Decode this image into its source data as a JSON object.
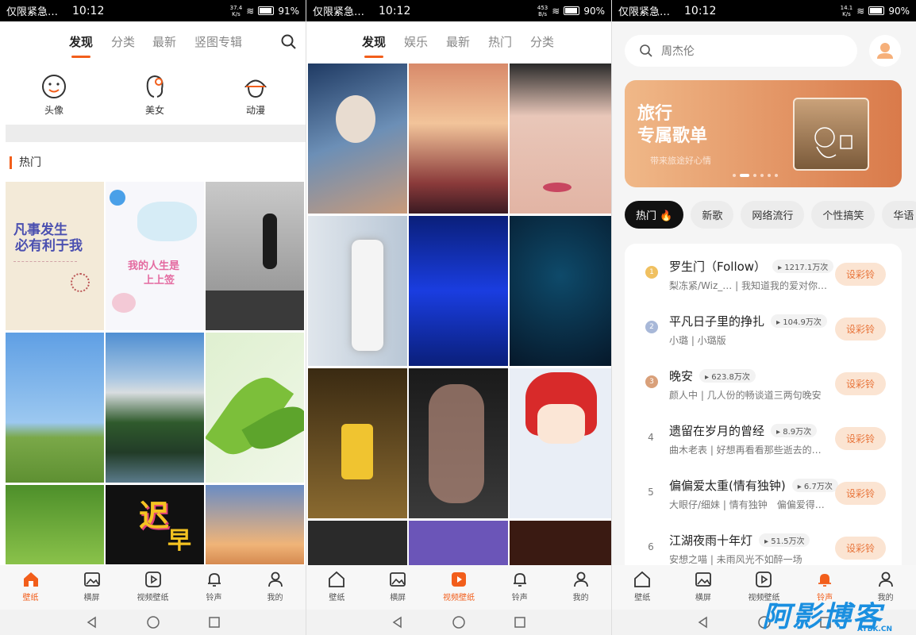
{
  "status": {
    "p1": {
      "carrier": "仅限紧急…",
      "time": "10:12",
      "speed_top": "37.4",
      "speed_unit": "K/s",
      "battery": "91%"
    },
    "p2": {
      "carrier": "仅限紧急…",
      "time": "10:12",
      "speed_top": "453",
      "speed_unit": "B/s",
      "battery": "90%"
    },
    "p3": {
      "carrier": "仅限紧急…",
      "time": "10:12",
      "speed_top": "14.1",
      "speed_unit": "K/s",
      "battery": "90%"
    }
  },
  "p1": {
    "tabs": [
      "发现",
      "分类",
      "最新",
      "竖图专辑"
    ],
    "categories": [
      {
        "label": "头像",
        "icon": "smile-face-icon"
      },
      {
        "label": "美女",
        "icon": "girl-face-icon"
      },
      {
        "label": "动漫",
        "icon": "anime-face-icon"
      }
    ],
    "hot_title": "热门",
    "tile_text": {
      "a": "凡事发生",
      "b": "必有利于我",
      "c": "我的人生是",
      "d": "上上签",
      "e": "迟",
      "f": "早"
    }
  },
  "p2": {
    "tabs": [
      "发现",
      "娱乐",
      "最新",
      "热门",
      "分类"
    ]
  },
  "p3": {
    "search_placeholder": "周杰伦",
    "banner": {
      "title1": "旅行",
      "title2": "专属歌单",
      "subtitle": "带来旅途好心情"
    },
    "chips": [
      "热门 🔥",
      "新歌",
      "网络流行",
      "个性搞笑",
      "华语"
    ],
    "songs": [
      {
        "rank": "1",
        "title": "罗生门（Follow）",
        "plays": "▸ 1217.1万次",
        "sub": "梨冻紧/Wiz_… | 我知道我的爱对你…",
        "btn": "设彩铃"
      },
      {
        "rank": "2",
        "title": "平凡日子里的挣扎",
        "plays": "▸ 104.9万次",
        "sub": "小璐 | 小璐版",
        "btn": "设彩铃"
      },
      {
        "rank": "3",
        "title": "晚安",
        "plays": "▸ 623.8万次",
        "sub": "颜人中 | 几人份的畅谈道三两句晚安",
        "btn": "设彩铃"
      },
      {
        "rank": "4",
        "title": "遗留在岁月的曾经",
        "plays": "▸ 8.9万次",
        "sub": "曲木老表 | 好想再看看那些逝去的…",
        "btn": "设彩铃"
      },
      {
        "rank": "5",
        "title": "偏偏爱太重(情有独钟)",
        "plays": "▸ 6.7万次",
        "sub": "大眼仔/细妹 | 情有独钟　偏偏爱得…",
        "btn": "设彩铃"
      },
      {
        "rank": "6",
        "title": "江湖夜雨十年灯",
        "plays": "▸ 51.5万次",
        "sub": "安想之喵 | 未雨风光不如醉一场",
        "btn": "设彩铃"
      }
    ]
  },
  "bottom_nav": {
    "p1": [
      "壁纸",
      "横屏",
      "视频壁纸",
      "铃声",
      "我的"
    ],
    "p2": [
      "壁纸",
      "横屏",
      "视频壁纸",
      "铃声",
      "我的"
    ],
    "p3": [
      "壁纸",
      "横屏",
      "视频壁纸",
      "铃声",
      "我的"
    ],
    "active": {
      "p1": 0,
      "p2": 2,
      "p3": 3
    },
    "accent": "#f25e1b"
  },
  "watermark": {
    "main": "阿影博客",
    "sub": "AYBK.CN"
  }
}
